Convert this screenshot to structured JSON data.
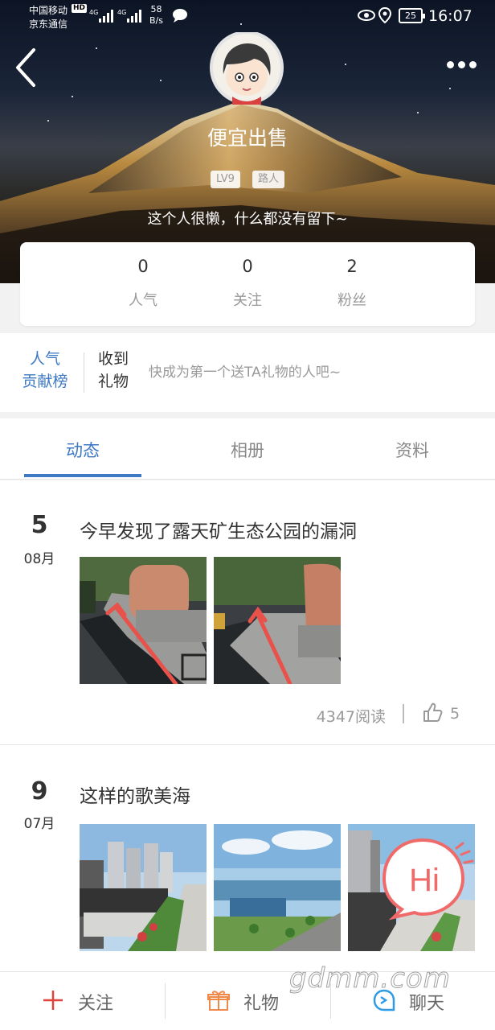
{
  "status_bar": {
    "carrier_1": "中国移动",
    "hd_badge": "HD",
    "carrier_2": "京东通信",
    "network_1": "4G",
    "network_2": "4G",
    "speed_value": "58",
    "speed_unit": "B/s",
    "battery": "25",
    "time": "16:07"
  },
  "profile": {
    "name": "便宜出售",
    "level_badge": "LV9",
    "role_badge": "路人",
    "bio": "这个人很懒，什么都没有留下~"
  },
  "stats": [
    {
      "value": "0",
      "label": "人气"
    },
    {
      "value": "0",
      "label": "关注"
    },
    {
      "value": "2",
      "label": "粉丝"
    }
  ],
  "gifts": {
    "rank_line1": "人气",
    "rank_line2": "贡献榜",
    "received_line1": "收到",
    "received_line2": "礼物",
    "empty_text": "快成为第一个送TA礼物的人吧~"
  },
  "tabs": [
    "动态",
    "相册",
    "资料"
  ],
  "active_tab": "动态",
  "posts": [
    {
      "day": "5",
      "month": "08月",
      "title": "今早发现了露天矿生态公园的漏洞",
      "reads": "4347阅读",
      "likes": "5"
    },
    {
      "day": "9",
      "month": "07月",
      "title": "这样的歌美海"
    }
  ],
  "hi_button": "Hi",
  "bottom_bar": {
    "follow": "关注",
    "gift": "礼物",
    "chat": "聊天"
  },
  "watermark": "gdmm.com",
  "colors": {
    "accent": "#3d78c4",
    "plus_red": "#e0423c",
    "gift_orange": "#f0884a",
    "chat_blue": "#2f9be6",
    "hi_red": "#f06a6a"
  }
}
